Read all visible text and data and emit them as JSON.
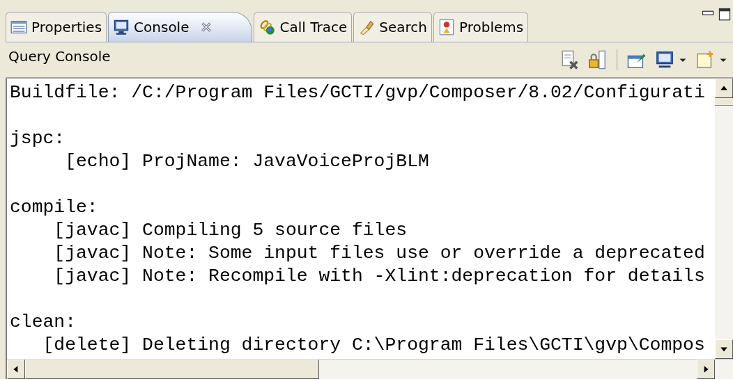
{
  "tabs": [
    {
      "label": "Properties",
      "selected": false
    },
    {
      "label": "Console",
      "selected": true
    },
    {
      "label": "Call Trace",
      "selected": false
    },
    {
      "label": "Search",
      "selected": false
    },
    {
      "label": "Problems",
      "selected": false
    }
  ],
  "console": {
    "title": "Query Console",
    "blocks": [
      [
        "Buildfile: /C:/Program Files/GCTI/gvp/Composer/8.02/Configurati"
      ],
      [
        "jspc:",
        "     [echo] ProjName: JavaVoiceProjBLM"
      ],
      [
        "compile:",
        "    [javac] Compiling 5 source files",
        "    [javac] Note: Some input files use or override a deprecated",
        "    [javac] Note: Recompile with -Xlint:deprecation for details"
      ],
      [
        "clean:",
        "   [delete] Deleting directory C:\\Program Files\\GCTI\\gvp\\Compos"
      ]
    ]
  }
}
